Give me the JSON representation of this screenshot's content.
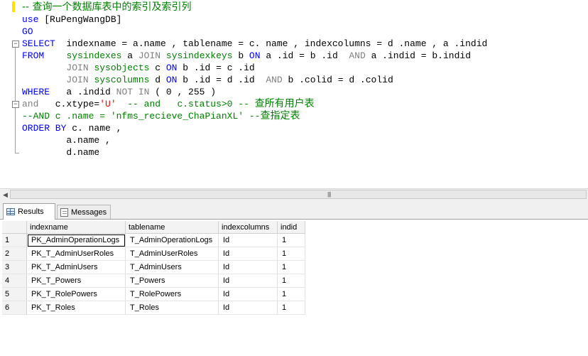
{
  "editor": {
    "lines": [
      [
        {
          "t": "-- 查询一个数据库表中的索引及索引列",
          "c": "cm zh"
        }
      ],
      [
        {
          "t": "use ",
          "c": "kw"
        },
        {
          "t": "[RuPengWangDB]",
          "c": ""
        }
      ],
      [
        {
          "t": "GO",
          "c": "kw"
        }
      ],
      [
        {
          "t": "SELECT",
          "c": "kw"
        },
        {
          "t": "  indexname = a.name , tablename = c. name , indexcolumns = d .name , a .indid",
          "c": ""
        }
      ],
      [
        {
          "t": "FROM",
          "c": "kw"
        },
        {
          "t": "    ",
          "c": ""
        },
        {
          "t": "sysindexes",
          "c": "gn"
        },
        {
          "t": " a ",
          "c": ""
        },
        {
          "t": "JOIN",
          "c": "gr"
        },
        {
          "t": " ",
          "c": ""
        },
        {
          "t": "sysindexkeys",
          "c": "gn"
        },
        {
          "t": " b ",
          "c": ""
        },
        {
          "t": "ON",
          "c": "kw"
        },
        {
          "t": " a .id = b .id  ",
          "c": ""
        },
        {
          "t": "AND",
          "c": "gr"
        },
        {
          "t": " a .indid = b.indid",
          "c": ""
        }
      ],
      [
        {
          "t": "        ",
          "c": ""
        },
        {
          "t": "JOIN",
          "c": "gr"
        },
        {
          "t": " ",
          "c": ""
        },
        {
          "t": "sysobjects",
          "c": "gn"
        },
        {
          "t": " c ",
          "c": ""
        },
        {
          "t": "ON",
          "c": "kw"
        },
        {
          "t": " b .id = c .id",
          "c": ""
        }
      ],
      [
        {
          "t": "        ",
          "c": ""
        },
        {
          "t": "JOIN",
          "c": "gr"
        },
        {
          "t": " ",
          "c": ""
        },
        {
          "t": "syscolumns",
          "c": "gn"
        },
        {
          "t": " d ",
          "c": ""
        },
        {
          "t": "ON",
          "c": "kw"
        },
        {
          "t": " b .id = d .id  ",
          "c": ""
        },
        {
          "t": "AND",
          "c": "gr"
        },
        {
          "t": " b .colid = d .colid",
          "c": ""
        }
      ],
      [
        {
          "t": "WHERE",
          "c": "kw"
        },
        {
          "t": "   a .indid ",
          "c": ""
        },
        {
          "t": "NOT IN",
          "c": "gr"
        },
        {
          "t": " ( 0 , 255 )",
          "c": ""
        }
      ],
      [
        {
          "t": "and",
          "c": "gr"
        },
        {
          "t": "   c.xtype=",
          "c": ""
        },
        {
          "t": "'U'",
          "c": "rd"
        },
        {
          "t": "  -- and   c.status>0 -- ",
          "c": "cm"
        },
        {
          "t": "查所有用户表",
          "c": "cm zh"
        }
      ],
      [
        {
          "t": "--AND c .name = 'nfms_recieve_ChaPianXL' --",
          "c": "cm"
        },
        {
          "t": "查指定表",
          "c": "cm zh"
        }
      ],
      [
        {
          "t": "ORDER BY",
          "c": "kw"
        },
        {
          "t": " c. name ,",
          "c": ""
        }
      ],
      [
        {
          "t": "        a.name ,",
          "c": ""
        }
      ],
      [
        {
          "t": "        d.name",
          "c": ""
        }
      ]
    ]
  },
  "tabs": {
    "results_label": "Results",
    "messages_label": "Messages"
  },
  "results": {
    "columns": [
      "indexname",
      "tablename",
      "indexcolumns",
      "indid"
    ],
    "rows": [
      [
        "1",
        "PK_AdminOperationLogs",
        "T_AdminOperationLogs",
        "Id",
        "1"
      ],
      [
        "2",
        "PK_T_AdminUserRoles",
        "T_AdminUserRoles",
        "Id",
        "1"
      ],
      [
        "3",
        "PK_T_AdminUsers",
        "T_AdminUsers",
        "Id",
        "1"
      ],
      [
        "4",
        "PK_T_Powers",
        "T_Powers",
        "Id",
        "1"
      ],
      [
        "5",
        "PK_T_RolePowers",
        "T_RolePowers",
        "Id",
        "1"
      ],
      [
        "6",
        "PK_T_Roles",
        "T_Roles",
        "Id",
        "1"
      ]
    ]
  }
}
